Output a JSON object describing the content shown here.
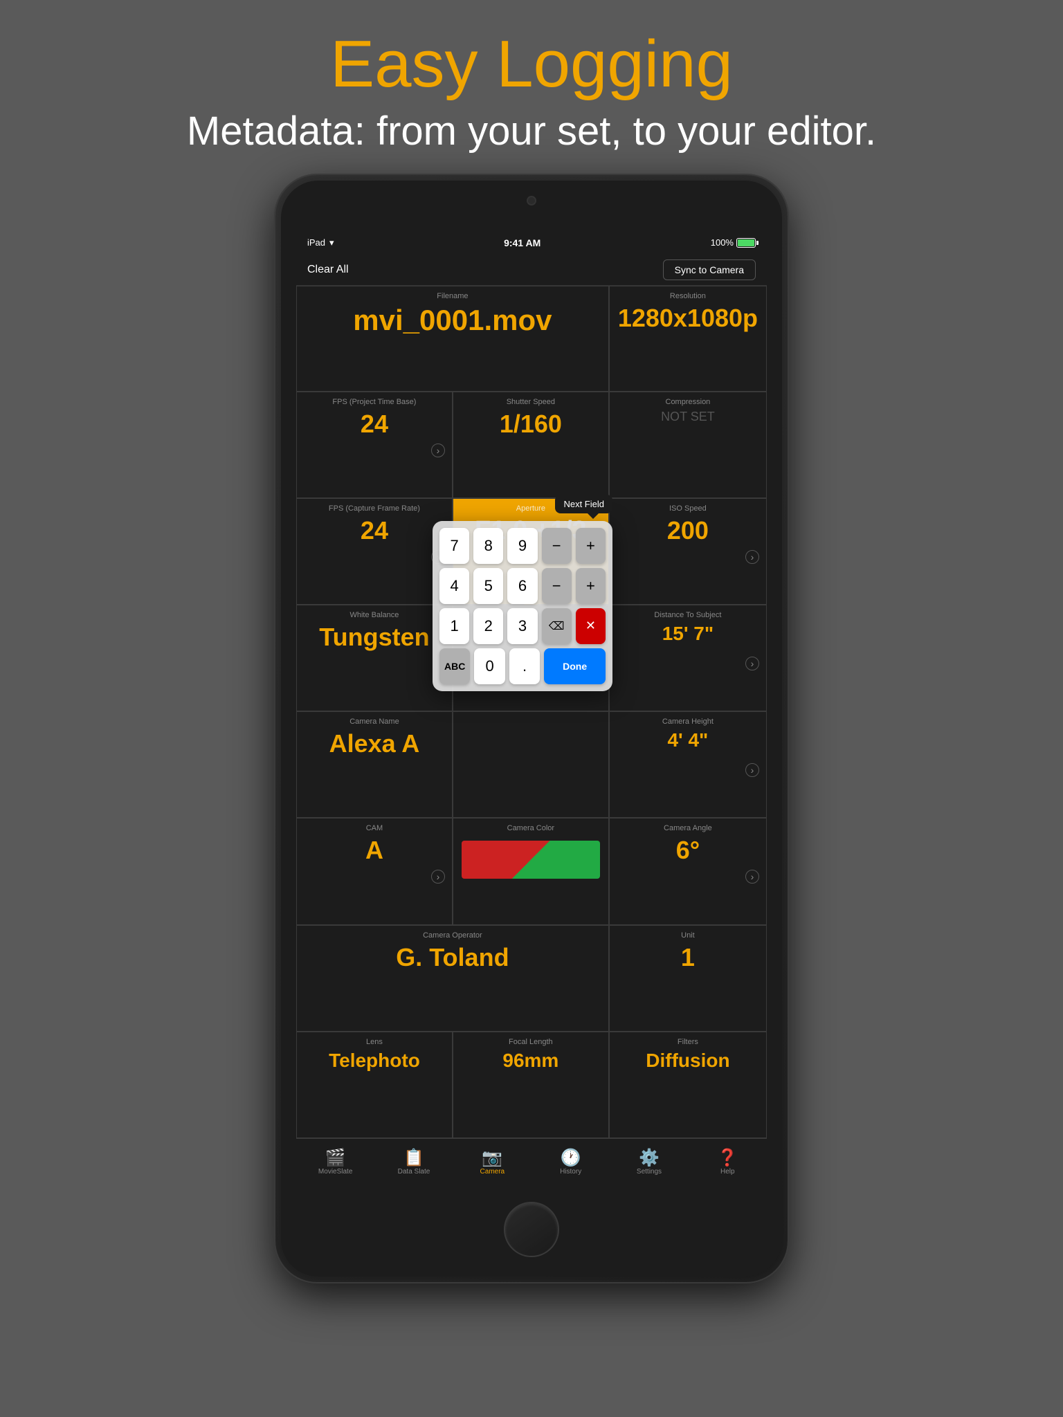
{
  "page": {
    "title": "Easy Logging",
    "subtitle": "Metadata: from your set, to your editor."
  },
  "status_bar": {
    "device": "iPad",
    "wifi": "WiFi",
    "time": "9:41 AM",
    "battery": "100%"
  },
  "top_bar": {
    "clear_label": "Clear All",
    "sync_label": "Sync to Camera"
  },
  "cells": {
    "filename_label": "Filename",
    "filename_value": "mvi_0001.mov",
    "resolution_label": "Resolution",
    "resolution_value": "1280x1080p",
    "fps_label": "FPS (Project Time Base)",
    "fps_value": "24",
    "shutter_label": "Shutter Speed",
    "shutter_value": "1/160",
    "compression_label": "Compression",
    "compression_value": "NOT SET",
    "fps2_label": "FPS (Capture Frame Rate)",
    "fps2_value": "24",
    "aperture_label": "Aperture",
    "aperture_value": "F1.0 +1/3",
    "iso_label": "ISO Speed",
    "iso_value": "200",
    "wb_label": "White Balance",
    "wb_value": "Tungsten",
    "distance_label": "Distance To Subject",
    "distance_value": "15' 7\"",
    "cam_name_label": "Camera Name",
    "cam_name_value": "Alexa A",
    "cam_height_label": "Camera Height",
    "cam_height_value": "4' 4\"",
    "cam_label": "CAM",
    "cam_value": "A",
    "cam_color_label": "Camera Color",
    "cam_angle_label": "Camera Angle",
    "cam_angle_value": "6°",
    "operator_label": "Camera Operator",
    "operator_value": "G. Toland",
    "unit_label": "Unit",
    "unit_value": "1",
    "lens_label": "Lens",
    "lens_value": "Telephoto",
    "focal_label": "Focal Length",
    "focal_value": "96mm",
    "filters_label": "Filters",
    "filters_value": "Diffusion"
  },
  "numpad": {
    "hint": "Next Field",
    "keys": [
      [
        "7",
        "8",
        "9"
      ],
      [
        "4",
        "5",
        "6"
      ],
      [
        "1",
        "2",
        "3"
      ],
      [
        "ABC",
        "0",
        ".",
        null,
        null
      ]
    ],
    "done": "Done"
  },
  "tabs": [
    {
      "label": "MovieSlate",
      "icon": "🎬",
      "active": false
    },
    {
      "label": "Data Slate",
      "icon": "📋",
      "active": false
    },
    {
      "label": "Camera",
      "icon": "📷",
      "active": true
    },
    {
      "label": "History",
      "icon": "🕐",
      "active": false
    },
    {
      "label": "Settings",
      "icon": "⚙️",
      "active": false
    },
    {
      "label": "Help",
      "icon": "❓",
      "active": false
    }
  ]
}
